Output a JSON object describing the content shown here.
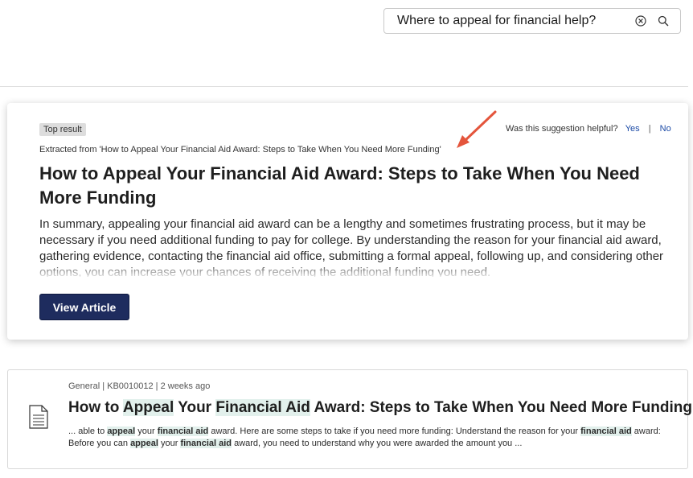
{
  "search": {
    "query": "Where to appeal for financial help?",
    "clear_icon": "clear-circle-icon",
    "search_icon": "search-icon"
  },
  "top_result": {
    "badge": "Top result",
    "helpful_question": "Was this suggestion helpful?",
    "helpful_yes": "Yes",
    "helpful_separator": "|",
    "helpful_no": "No",
    "extracted_from": "Extracted from 'How to Appeal Your Financial Aid Award: Steps to Take When You Need More Funding'",
    "title": "How to Appeal Your Financial Aid Award: Steps to Take When You Need More Funding",
    "summary": "In summary, appealing your financial aid award can be a lengthy and sometimes frustrating process, but it may be necessary if you need additional funding to pay for college. By understanding the reason for your financial aid award, gathering evidence, contacting the financial aid office, submitting a formal appeal, following up, and considering other options, you can increase your chances of receiving the additional funding you need.",
    "button_label": "View Article",
    "annotation_color": "#e4553c"
  },
  "results": [
    {
      "meta": "General | KB0010012 | 2 weeks ago",
      "icon": "document-icon",
      "title": {
        "t1": "How to ",
        "h1": "Appeal",
        "t2": " Your ",
        "h2": "Financial Aid",
        "t3": " Award: Steps to Take When You Need More Funding"
      },
      "snippet": {
        "s1": "... able to ",
        "h1": "appeal",
        "s2": " your ",
        "h2": "financial aid",
        "s3": " award. Here are some steps to take if you need more funding: Understand the reason for your ",
        "h3": "financial aid",
        "s4": " award: Before you can ",
        "h4": "appeal",
        "s5": " your ",
        "h5": "financial aid",
        "s6": " award, you need to understand why you were awarded the amount you ..."
      }
    }
  ],
  "colors": {
    "button": "#1e2c5e",
    "link": "#1b4aa6",
    "highlight": "#e2f0ec"
  }
}
